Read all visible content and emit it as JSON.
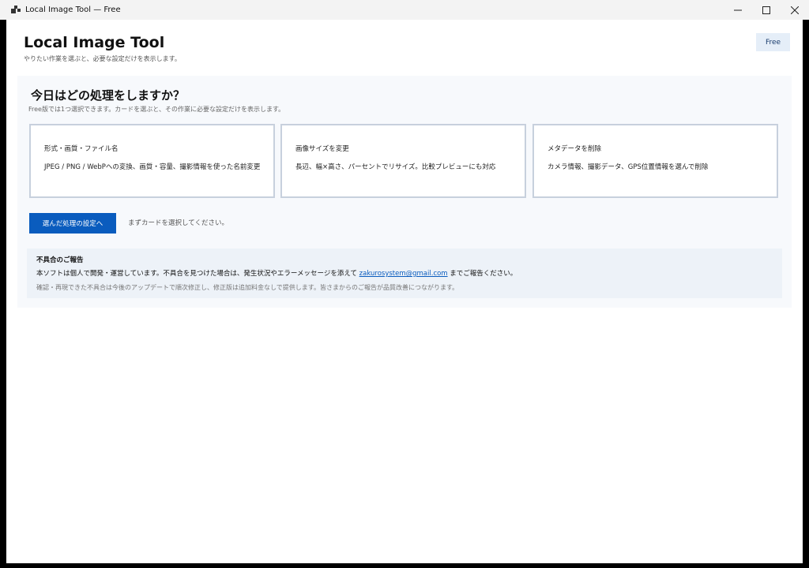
{
  "window": {
    "title": "Local Image Tool — Free",
    "controls": {
      "minimize": "—",
      "maximize": "☐",
      "close": "✕"
    }
  },
  "header": {
    "title": "Local Image Tool",
    "subtitle": "やりたい作業を選ぶと、必要な設定だけを表示します。",
    "badge": "Free"
  },
  "panel": {
    "heading": "今日はどの処理をしますか？",
    "subtitle": "Free版では1つ選択できます。カードを選ぶと、その作業に必要な設定だけを表示します。",
    "cards": [
      {
        "title": "形式・画質・ファイル名",
        "desc": "JPEG / PNG / WebPへの変換、画質・容量、撮影情報を使った名前変更"
      },
      {
        "title": "画像サイズを変更",
        "desc": "長辺、幅×高さ、パーセントでリサイズ。比較プレビューにも対応"
      },
      {
        "title": "メタデータを削除",
        "desc": "カメラ情報、撮影データ、GPS位置情報を選んで削除"
      }
    ],
    "primary_button": "選んだ処理の設定へ",
    "hint": "まずカードを選択してください。"
  },
  "report": {
    "title": "不具合のご報告",
    "body_before": "本ソフトは個人で開発・運営しています。不具合を見つけた場合は、発生状況やエラーメッセージを添えて ",
    "email": "zakurosystem@gmail.com",
    "body_after": " までご報告ください。",
    "note": "確認・再現できた不具合は今後のアップデートで順次修正し、修正版は追加料金なしで提供します。皆さまからのご報告が品質改善につながります。"
  }
}
